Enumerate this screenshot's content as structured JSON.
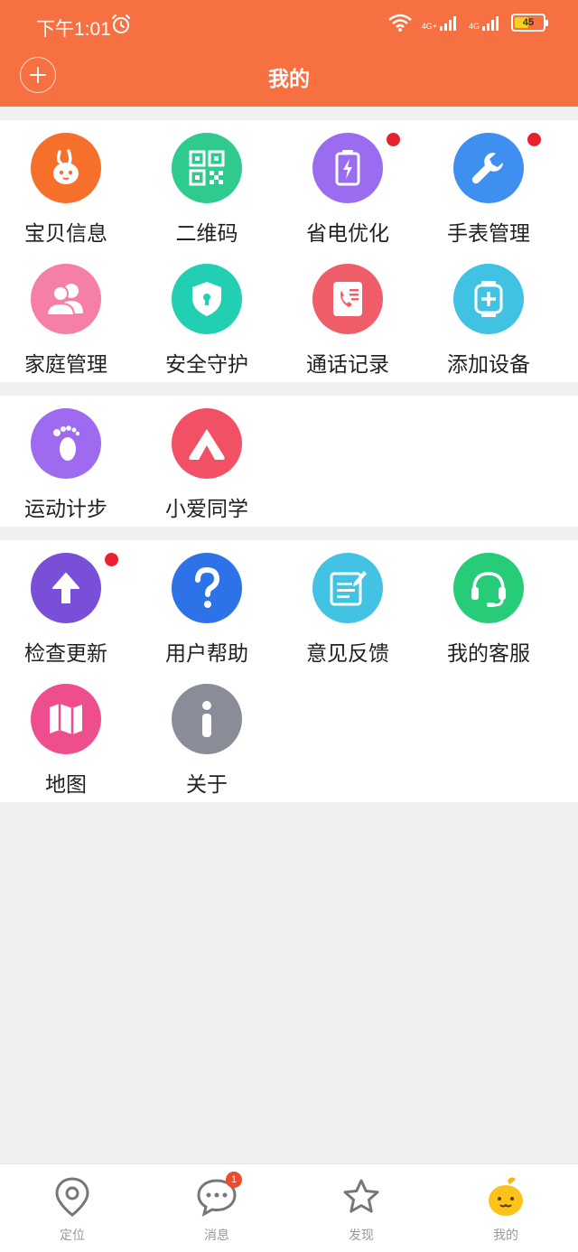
{
  "status_bar": {
    "time": "下午1:01",
    "network_1": "4G+",
    "network_2": "4G",
    "battery": "45",
    "battery_level_percent": 45
  },
  "header": {
    "title": "我的"
  },
  "section1": {
    "items": [
      {
        "label": "宝贝信息",
        "icon": "rabbit-icon",
        "color": "#f6702b",
        "dot": false
      },
      {
        "label": "二维码",
        "icon": "qr-code-icon",
        "color": "#2fcb8e",
        "dot": false
      },
      {
        "label": "省电优化",
        "icon": "battery-saver-icon",
        "color": "#9a6cf0",
        "dot": true
      },
      {
        "label": "手表管理",
        "icon": "wrench-icon",
        "color": "#3f8ff0",
        "dot": true
      },
      {
        "label": "家庭管理",
        "icon": "family-icon",
        "color": "#f57fa5",
        "dot": false
      },
      {
        "label": "安全守护",
        "icon": "shield-icon",
        "color": "#22cfb2",
        "dot": false
      },
      {
        "label": "通话记录",
        "icon": "call-log-icon",
        "color": "#ef5d68",
        "dot": false
      },
      {
        "label": "添加设备",
        "icon": "add-device-icon",
        "color": "#40c2e2",
        "dot": false
      }
    ]
  },
  "section2": {
    "items": [
      {
        "label": "运动计步",
        "icon": "footprint-icon",
        "color": "#9d6af0",
        "dot": false
      },
      {
        "label": "小爱同学",
        "icon": "xiaoai-icon",
        "color": "#f25064",
        "dot": false
      }
    ]
  },
  "section3": {
    "items": [
      {
        "label": "检查更新",
        "icon": "arrow-up-icon",
        "color": "#7a4fd8",
        "dot": true
      },
      {
        "label": "用户帮助",
        "icon": "question-icon",
        "color": "#2d72e6",
        "dot": false
      },
      {
        "label": "意见反馈",
        "icon": "feedback-icon",
        "color": "#42c3e4",
        "dot": false
      },
      {
        "label": "我的客服",
        "icon": "headset-icon",
        "color": "#27cc78",
        "dot": false
      },
      {
        "label": "地图",
        "icon": "map-icon",
        "color": "#ef4e8e",
        "dot": false
      },
      {
        "label": "关于",
        "icon": "info-icon",
        "color": "#8a8d97",
        "dot": false
      }
    ]
  },
  "bottom_nav": {
    "items": [
      {
        "label": "定位",
        "icon": "location-pin-icon"
      },
      {
        "label": "消息",
        "icon": "chat-bubble-icon",
        "badge": "1"
      },
      {
        "label": "发现",
        "icon": "star-icon"
      },
      {
        "label": "我的",
        "icon": "mascot-icon",
        "active": true
      }
    ]
  }
}
